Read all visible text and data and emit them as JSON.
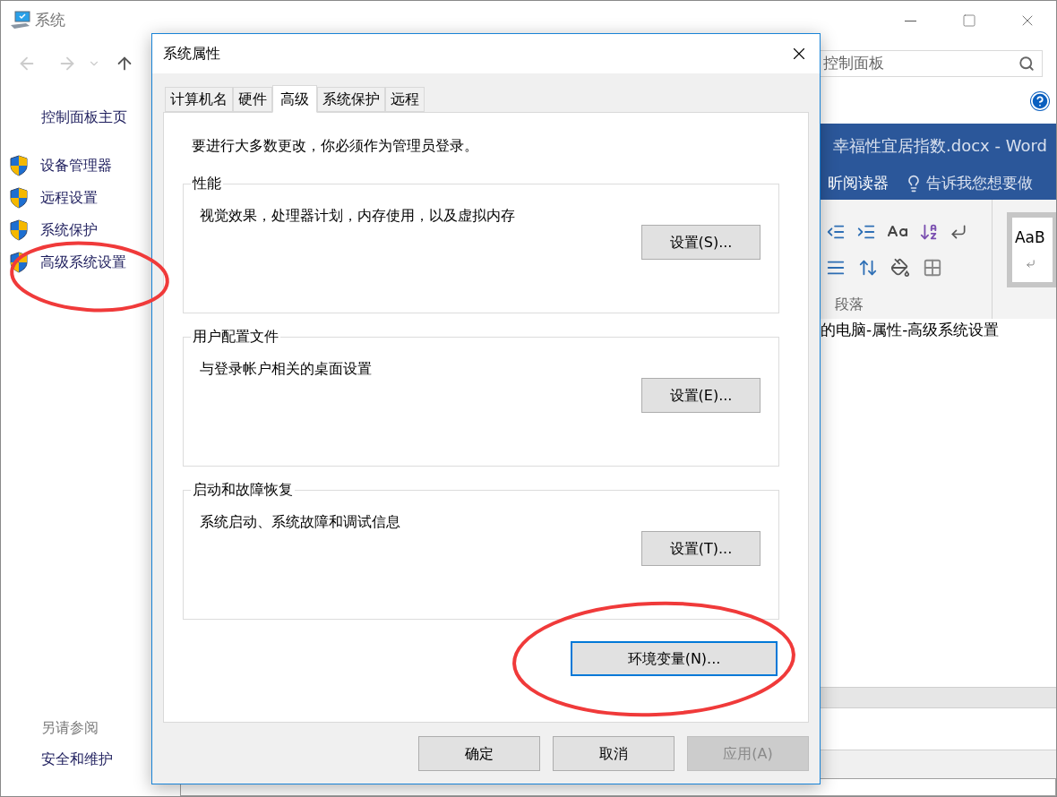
{
  "background_window": {
    "title": "系统",
    "search": {
      "placeholder": "控制面板"
    },
    "sidebar": {
      "home_link": "控制面板主页",
      "items": [
        {
          "label": "设备管理器"
        },
        {
          "label": "远程设置"
        },
        {
          "label": "系统保护"
        },
        {
          "label": "高级系统设置"
        }
      ],
      "see_also": {
        "heading": "另请参阅",
        "links": [
          "安全和维护"
        ]
      }
    }
  },
  "word_window": {
    "title": "幸福性宜居指数.docx - Word",
    "ribbon_tab": "昕阅读器",
    "tell_me": "告诉我您想要做",
    "group_label": "段落",
    "style_preview": "AaB",
    "document_text": "的电脑-属性-高级系统设置"
  },
  "dialog": {
    "title": "系统属性",
    "tabs": [
      {
        "label": "计算机名",
        "selected": false
      },
      {
        "label": "硬件",
        "selected": false
      },
      {
        "label": "高级",
        "selected": true
      },
      {
        "label": "系统保护",
        "selected": false
      },
      {
        "label": "远程",
        "selected": false
      }
    ],
    "notice": "要进行大多数更改，你必须作为管理员登录。",
    "groups": [
      {
        "title": "性能",
        "description": "视觉效果，处理器计划，内存使用，以及虚拟内存",
        "button": "设置(S)..."
      },
      {
        "title": "用户配置文件",
        "description": "与登录帐户相关的桌面设置",
        "button": "设置(E)..."
      },
      {
        "title": "启动和故障恢复",
        "description": "系统启动、系统故障和调试信息",
        "button": "设置(T)..."
      }
    ],
    "env_button": {
      "label": "环境变量(N)...",
      "focused": true
    },
    "buttons": [
      {
        "label": "确定",
        "disabled": false
      },
      {
        "label": "取消",
        "disabled": false
      },
      {
        "label": "应用(A)",
        "disabled": true
      }
    ]
  }
}
